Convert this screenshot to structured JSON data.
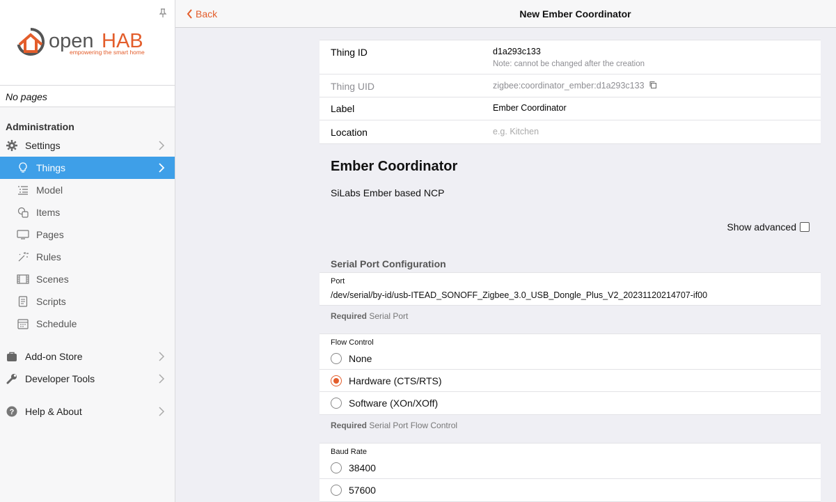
{
  "sidebar": {
    "brand": {
      "name_part1": "open",
      "name_part2": "HAB",
      "tagline": "empowering the smart home"
    },
    "no_pages": "No pages",
    "admin_title": "Administration",
    "items": [
      {
        "label": "Settings",
        "icon": "gear-icon"
      },
      {
        "label": "Things",
        "icon": "lightbulb-icon"
      },
      {
        "label": "Model",
        "icon": "list-icon"
      },
      {
        "label": "Items",
        "icon": "items-icon"
      },
      {
        "label": "Pages",
        "icon": "monitor-icon"
      },
      {
        "label": "Rules",
        "icon": "wand-icon"
      },
      {
        "label": "Scenes",
        "icon": "film-icon"
      },
      {
        "label": "Scripts",
        "icon": "doc-icon"
      },
      {
        "label": "Schedule",
        "icon": "calendar-icon"
      }
    ],
    "bottom": [
      {
        "label": "Add-on Store",
        "icon": "bag-icon"
      },
      {
        "label": "Developer Tools",
        "icon": "wrench-icon"
      },
      {
        "label": "Help & About",
        "icon": "help-icon"
      }
    ]
  },
  "header": {
    "back_label": "Back",
    "title": "New Ember Coordinator"
  },
  "thing": {
    "id_label": "Thing ID",
    "id_value": "d1a293c133",
    "id_note": "Note: cannot be changed after the creation",
    "uid_label": "Thing UID",
    "uid_value": "zigbee:coordinator_ember:d1a293c133",
    "label_label": "Label",
    "label_value": "Ember Coordinator",
    "location_label": "Location",
    "location_placeholder": "e.g. Kitchen",
    "title": "Ember Coordinator",
    "description": "SiLabs Ember based NCP",
    "show_advanced": "Show advanced"
  },
  "config": {
    "group_title": "Serial Port Configuration",
    "port": {
      "label": "Port",
      "value": "/dev/serial/by-id/usb-ITEAD_SONOFF_Zigbee_3.0_USB_Dongle_Plus_V2_20231120214707-if00",
      "required": "Required",
      "hint": "Serial Port"
    },
    "flow": {
      "label": "Flow Control",
      "options": [
        "None",
        "Hardware (CTS/RTS)",
        "Software (XOn/XOff)"
      ],
      "selected": "Hardware (CTS/RTS)",
      "required": "Required",
      "hint": "Serial Port Flow Control"
    },
    "baud": {
      "label": "Baud Rate",
      "options": [
        "38400",
        "57600"
      ]
    }
  },
  "colors": {
    "accent": "#e35d2b",
    "active_nav": "#3e9fe8"
  }
}
